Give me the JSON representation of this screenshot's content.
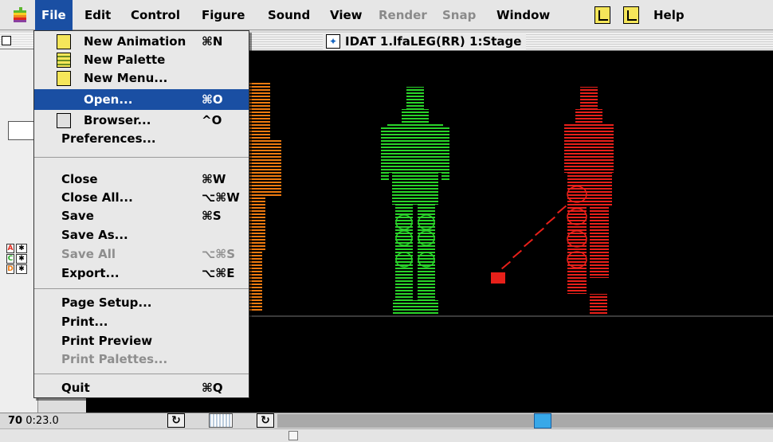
{
  "menubar": {
    "items": [
      {
        "label": "File"
      },
      {
        "label": "Edit"
      },
      {
        "label": "Control"
      },
      {
        "label": "Figure"
      },
      {
        "label": "Sound"
      },
      {
        "label": "View"
      },
      {
        "label": "Render"
      },
      {
        "label": "Snap"
      },
      {
        "label": "Window"
      },
      {
        "label": "Help"
      }
    ]
  },
  "file_menu": {
    "items": [
      {
        "label": "New Animation",
        "shortcut": "⌘N",
        "icon": "animation-icon"
      },
      {
        "label": "New Palette",
        "shortcut": "",
        "icon": "palette-icon"
      },
      {
        "label": "New Menu...",
        "shortcut": "",
        "icon": "menu-icon"
      },
      {
        "label": "Open...",
        "shortcut": "⌘O"
      },
      {
        "label": "Browser...",
        "shortcut": "^O",
        "icon": "browser-icon"
      },
      {
        "label": "Preferences...",
        "shortcut": ""
      },
      {
        "label": "Close",
        "shortcut": "⌘W"
      },
      {
        "label": "Close All...",
        "shortcut": "⌥⌘W"
      },
      {
        "label": "Save",
        "shortcut": "⌘S"
      },
      {
        "label": "Save As...",
        "shortcut": ""
      },
      {
        "label": "Save All",
        "shortcut": "⌥⌘S"
      },
      {
        "label": "Export...",
        "shortcut": "⌥⌘E"
      },
      {
        "label": "Page Setup...",
        "shortcut": ""
      },
      {
        "label": "Print...",
        "shortcut": ""
      },
      {
        "label": "Print Preview",
        "shortcut": ""
      },
      {
        "label": "Print Palettes...",
        "shortcut": ""
      },
      {
        "label": "Quit",
        "shortcut": "⌘Q"
      }
    ]
  },
  "stage_window": {
    "title": "IDAT 1.lfaLEG(RR) 1:Stage"
  },
  "tracks": [
    {
      "letter": "A",
      "color": "#e0281e"
    },
    {
      "letter": "C",
      "color": "#22aa22"
    },
    {
      "letter": "D",
      "color": "#ee7a10"
    }
  ],
  "statusbar": {
    "frame": "70",
    "time": "0:23.0"
  },
  "colors": {
    "menu_highlight": "#1a4fa3",
    "figure_orange": "#ee7a10",
    "figure_green": "#2ad42a",
    "figure_red": "#e8201a",
    "timeline_thumb": "#38a8e8"
  }
}
